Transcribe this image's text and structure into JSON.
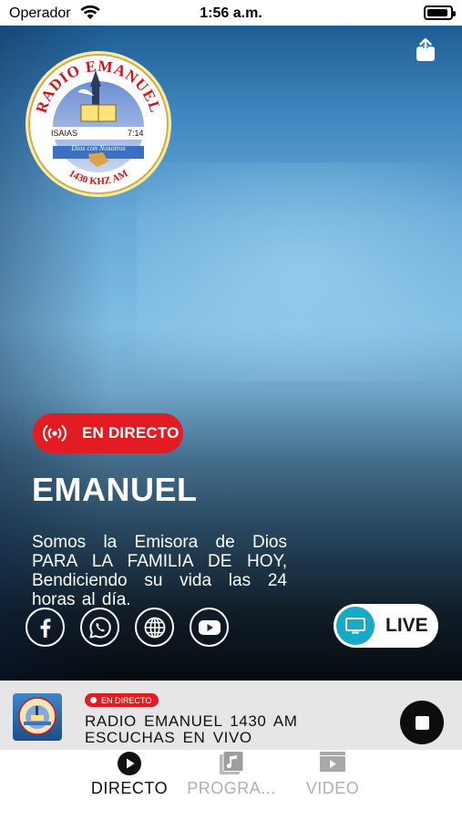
{
  "status_bar": {
    "carrier": "Operador",
    "time": "1:56 a.m.",
    "battery_level": 0.9
  },
  "hero": {
    "logo": {
      "top_text": "RADIO EMANUEL",
      "verse_book": "ISAIAS",
      "verse_ref": "7:14",
      "motto": "Dios con Nosotros",
      "bottom_text": "1430 KHZ AM"
    },
    "badge_label": "EN DIRECTO",
    "title": "EMANUEL",
    "description": "Somos la Emisora de Dios PARA LA FAMILIA DE HOY, Bendiciendo su vida las 24 horas al día.",
    "socials": [
      {
        "icon": "facebook-icon"
      },
      {
        "icon": "whatsapp-icon"
      },
      {
        "icon": "globe-icon"
      },
      {
        "icon": "youtube-icon"
      }
    ],
    "live_button_label": "LIVE"
  },
  "mini_player": {
    "badge_label": "EN DIRECTO",
    "title": "RADIO EMANUEL 1430 AM ESCUCHAS EN VIVO"
  },
  "tabs": [
    {
      "label": "DIRECTO",
      "icon": "play-circle-icon",
      "active": true
    },
    {
      "label": "PROGRA...",
      "icon": "music-note-icon",
      "active": false
    },
    {
      "label": "VIDEO",
      "icon": "video-play-icon",
      "active": false
    }
  ],
  "colors": {
    "accent_red": "#e31b23",
    "live_blue": "#18a9c9",
    "tab_active": "#111111",
    "tab_inactive": "#b0b0b0"
  }
}
